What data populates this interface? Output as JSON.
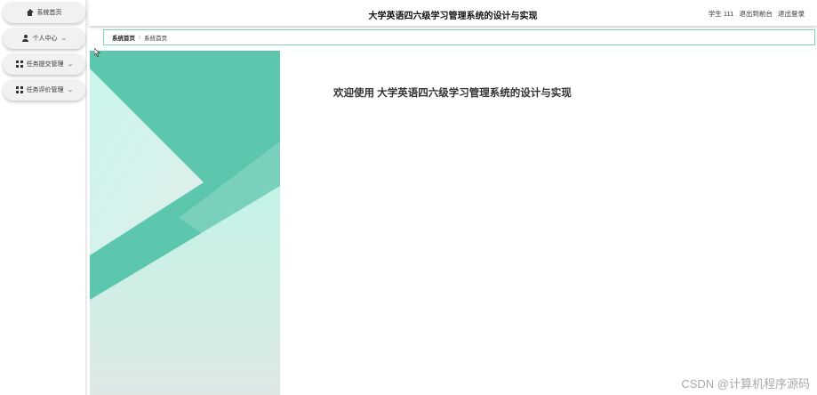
{
  "sidebar": {
    "items": [
      {
        "label": "系统首页",
        "icon": "home-icon",
        "has_chevron": false
      },
      {
        "label": "个人中心",
        "icon": "user-icon",
        "has_chevron": true
      },
      {
        "label": "任务提交管理",
        "icon": "grid-icon",
        "has_chevron": true
      },
      {
        "label": "任务评价管理",
        "icon": "grid-icon",
        "has_chevron": true
      }
    ]
  },
  "header": {
    "title": "大学英语四六级学习管理系统的设计与实现",
    "user_role": "学生",
    "user_name": "111",
    "back_to_front": "退出到前台",
    "logout": "退出登录"
  },
  "breadcrumb": {
    "home": "系统首页",
    "separator": "⁝",
    "current": "系统首页"
  },
  "main": {
    "welcome": "欢迎使用 大学英语四六级学习管理系统的设计与实现"
  },
  "watermark": "CSDN @计算机程序源码",
  "colors": {
    "accent": "#5cc6ae",
    "accent_light": "#c6f4ea",
    "breadcrumb_border": "#7fd1bb"
  }
}
